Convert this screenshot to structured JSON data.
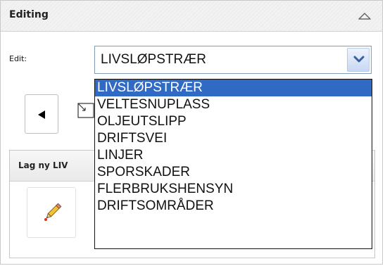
{
  "panel": {
    "title": "Editing",
    "collapse_icon": "chevron-up-icon"
  },
  "edit": {
    "label": "Edit:",
    "selected_value": "LIVSLØPSTRÆR",
    "options": [
      "LIVSLØPSTRÆR",
      "VELTESNUPLASS",
      "OLJEUTSLIPP",
      "DRIFTSVEI",
      "LINJER",
      "SPORSKADER",
      "FLERBRUKSHENSYN",
      "DRIFTSOMRÅDER"
    ],
    "highlighted_index": 0
  },
  "tools": {
    "select_tool_icon": "cursor-arrow-icon",
    "select_rect_icon": "select-rectangle-icon"
  },
  "create_panel": {
    "title": "Lag ny LIV",
    "create_icon": "pencil-icon"
  },
  "colors": {
    "highlight": "#316ac5",
    "select_border": "#7f9db9",
    "pencil_tip": "#e03020"
  }
}
